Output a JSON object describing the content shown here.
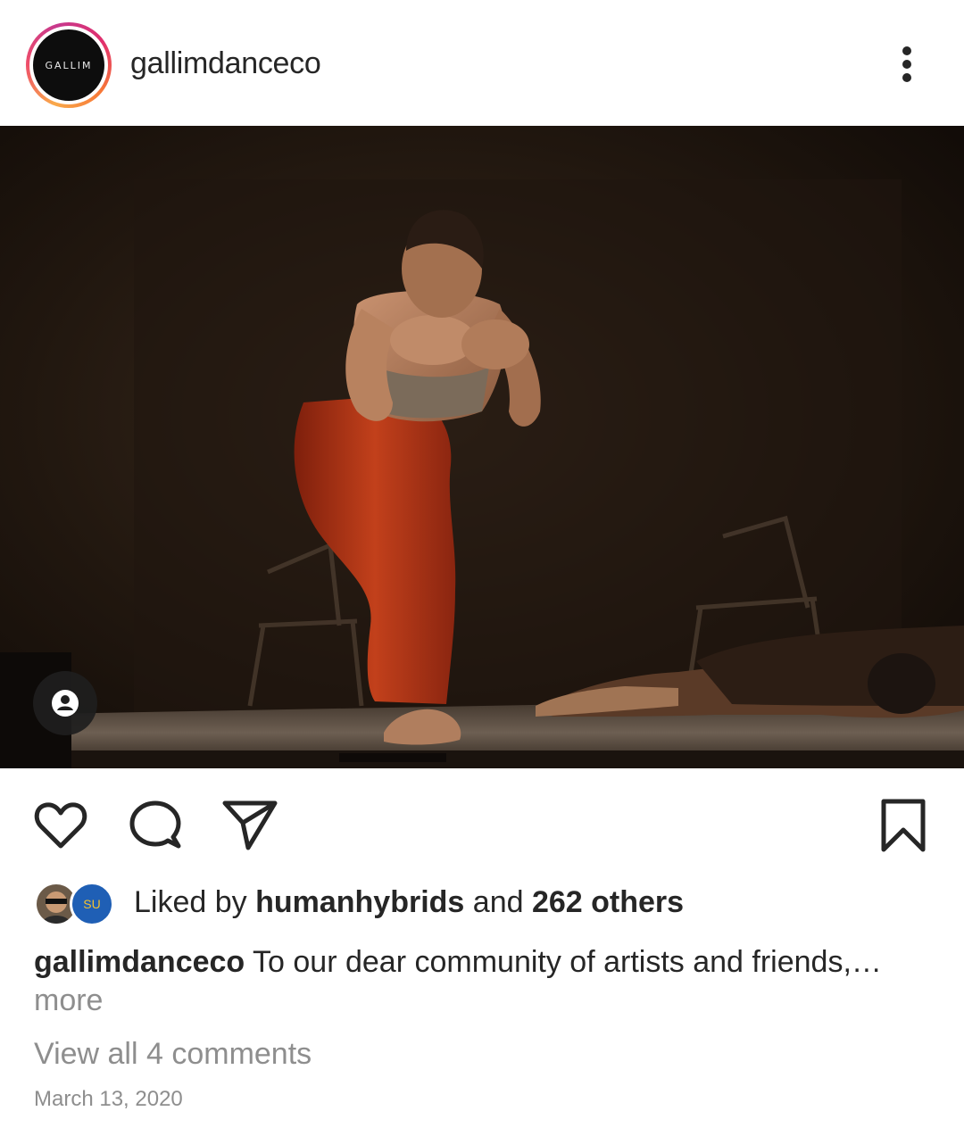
{
  "post": {
    "username": "gallimdanceco",
    "avatar_logo_text": "GALLIM",
    "photo_alt": "Dancer in red pants performing on a dark stage with another dancer lying on the floor",
    "likes": {
      "prefix": "Liked by ",
      "first_liker": "humanhybrids",
      "middle": " and ",
      "others": "262 others",
      "second_avatar_text": "SU"
    },
    "caption": {
      "username": "gallimdanceco",
      "text": "To our dear community of artists and friends,…",
      "more_label": "more"
    },
    "view_comments_label": "View all 4 comments",
    "date": "March 13, 2020"
  },
  "icons": {
    "more": "more-options-icon",
    "tag": "user-tag-icon",
    "like": "heart-icon",
    "comment": "comment-bubble-icon",
    "share": "paper-plane-icon",
    "save": "bookmark-icon"
  },
  "colors": {
    "text": "#262626",
    "secondary": "#8e8e8e",
    "ring_start": "#f9a94a",
    "ring_end": "#c7388d"
  }
}
